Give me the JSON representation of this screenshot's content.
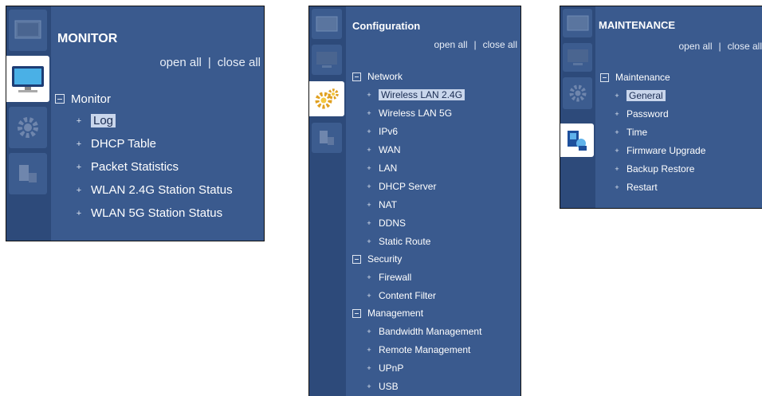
{
  "colors": {
    "panel_bg": "#3a5a8e",
    "strip_bg": "#2d4a7a",
    "selected_bg": "#c9d6ec"
  },
  "links": {
    "open_all": "open all",
    "separator": "|",
    "close_all": "close all"
  },
  "monitor": {
    "title": "MONITOR",
    "group": "Monitor",
    "items": [
      "Log",
      "DHCP Table",
      "Packet Statistics",
      "WLAN 2.4G Station Status",
      "WLAN 5G Station Status"
    ],
    "selected": "Log"
  },
  "configuration": {
    "title": "Configuration",
    "groups": [
      {
        "label": "Network",
        "items": [
          "Wireless LAN 2.4G",
          "Wireless LAN 5G",
          "IPv6",
          "WAN",
          "LAN",
          "DHCP Server",
          "NAT",
          "DDNS",
          "Static Route"
        ]
      },
      {
        "label": "Security",
        "items": [
          "Firewall",
          "Content Filter"
        ]
      },
      {
        "label": "Management",
        "items": [
          "Bandwidth Management",
          "Remote Management",
          "UPnP",
          "USB"
        ]
      }
    ],
    "selected": "Wireless LAN 2.4G"
  },
  "maintenance": {
    "title": "MAINTENANCE",
    "group": "Maintenance",
    "items": [
      "General",
      "Password",
      "Time",
      "Firmware Upgrade",
      "Backup Restore",
      "Restart"
    ],
    "selected": "General"
  },
  "icons": [
    "dashboard-icon",
    "monitor-icon",
    "configuration-gear-icon",
    "maintenance-icon"
  ]
}
